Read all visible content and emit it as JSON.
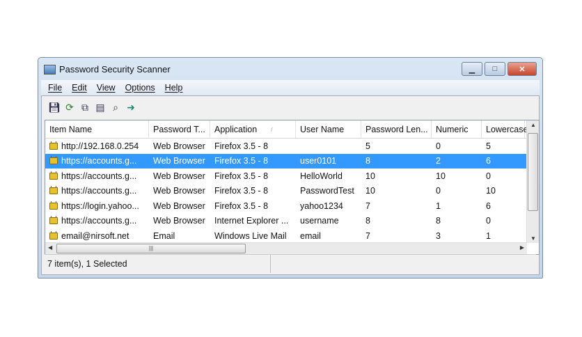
{
  "window": {
    "title": "Password Security Scanner"
  },
  "menu": [
    "File",
    "Edit",
    "View",
    "Options",
    "Help"
  ],
  "toolbar": [
    "save-icon",
    "refresh-icon",
    "copy-icon",
    "properties-icon",
    "find-icon",
    "exit-icon"
  ],
  "columns": [
    "Item Name",
    "Password T...",
    "Application",
    "User Name",
    "Password Len...",
    "Numeric",
    "Lowercase"
  ],
  "rows": [
    [
      "http://192.168.0.254",
      "Web Browser",
      "Firefox 3.5 - 8",
      "",
      "5",
      "0",
      "5"
    ],
    [
      "https://accounts.g...",
      "Web Browser",
      "Firefox 3.5 - 8",
      "user0101",
      "8",
      "2",
      "6"
    ],
    [
      "https://accounts.g...",
      "Web Browser",
      "Firefox 3.5 - 8",
      "HelloWorld",
      "10",
      "10",
      "0"
    ],
    [
      "https://accounts.g...",
      "Web Browser",
      "Firefox 3.5 - 8",
      "PasswordTest",
      "10",
      "0",
      "10"
    ],
    [
      "https://login.yahoo...",
      "Web Browser",
      "Firefox 3.5 - 8",
      "yahoo1234",
      "7",
      "1",
      "6"
    ],
    [
      "https://accounts.g...",
      "Web Browser",
      "Internet Explorer ...",
      "username",
      "8",
      "8",
      "0"
    ],
    [
      "email@nirsoft.net",
      "Email",
      "Windows Live Mail",
      "email",
      "7",
      "3",
      "1"
    ]
  ],
  "selected_row": 1,
  "status": "7 item(s), 1 Selected"
}
